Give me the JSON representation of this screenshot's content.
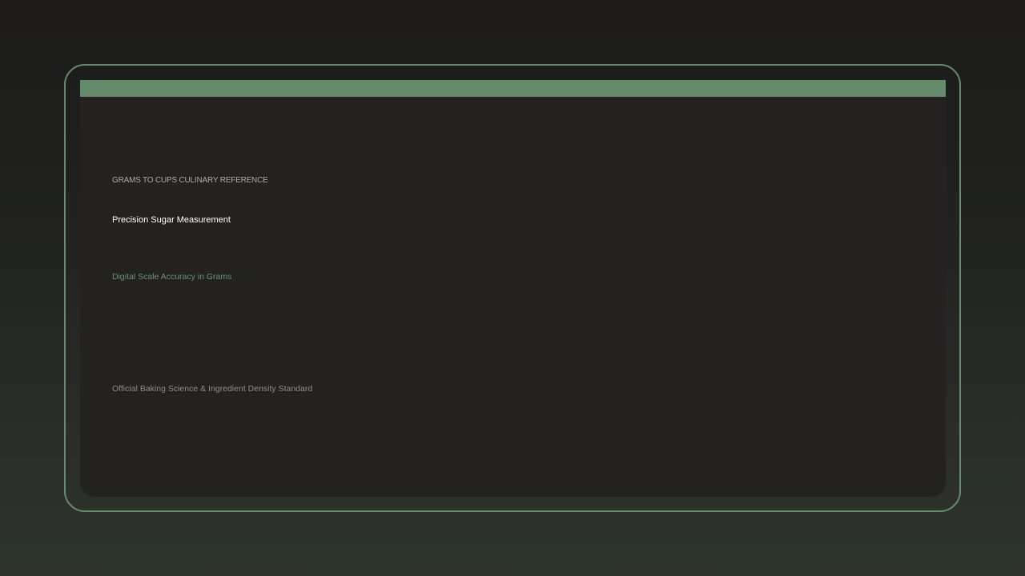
{
  "colors": {
    "accent": "#668a6c",
    "card_background": "#232220",
    "page_background_top": "#1b1a19",
    "page_background_bottom": "#2e352d",
    "title_text": "#ffffff",
    "subtitle_text": "#6a9370",
    "eyebrow_text": "#a9aaa6",
    "footer_text": "#8c8d89"
  },
  "card": {
    "eyebrow": "GRAMS TO CUPS CULINARY REFERENCE",
    "title": "Precision Sugar Measurement",
    "subtitle": "Digital Scale Accuracy in Grams",
    "footer_note": "Official Baking Science & Ingredient Density Standard"
  }
}
